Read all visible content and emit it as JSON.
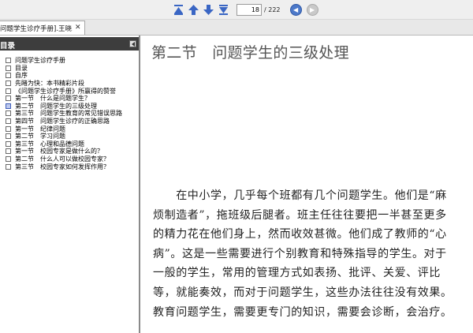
{
  "toolbar": {
    "current_page": "18",
    "total_pages": "/ 222",
    "buttons": [
      "first-page-icon",
      "previous-page-icon",
      "next-page-icon",
      "last-page-icon",
      "go-back-icon",
      "go-forward-icon"
    ],
    "accent_color": "#4d79c9"
  },
  "tab": {
    "title": "问题学生诊疗手册].王晓...",
    "close": "✕"
  },
  "sidebar": {
    "title": "目录",
    "items": [
      {
        "label": "问题学生诊疗手册"
      },
      {
        "label": "目录"
      },
      {
        "label": "自序"
      },
      {
        "label": "先睹为快：本书精彩片段"
      },
      {
        "label": "《问题学生诊疗手册》所赢得的赞誉"
      },
      {
        "label": "第一节　什么是问题学生？"
      },
      {
        "label": "第二节　问题学生的三级处理"
      },
      {
        "label": "第三节　问题学生教育的常见错误思路"
      },
      {
        "label": "第四节　问题学生诊疗的正确思路"
      },
      {
        "label": "第一节　纪律问题"
      },
      {
        "label": "第二节　学习问题"
      },
      {
        "label": "第三节　心理和品德问题"
      },
      {
        "label": "第一节　校园专家是做什么的？"
      },
      {
        "label": "第二节　什么人可以做校园专家？"
      },
      {
        "label": "第三节　校园专家如何发挥作用？"
      }
    ],
    "active_index": 6
  },
  "document": {
    "chapter_title": "第二节　问题学生的三级处理",
    "paragraph_lines": [
      "　　在中小学，几乎每个班都有几个问题学生。他们是“麻",
      "烦制造者”，拖班级后腿者。班主任往往要把一半甚至更多",
      "的精力花在他们身上，然而收效甚微。他们成了教师的“心",
      "病”。这是一些需要进行个别教育和特殊指导的学生。对于",
      "一般的学生，常用的管理方式如表扬、批评、关爱、评比",
      "等，就能奏效，而对于问题学生，这些办法往往没有效果。",
      "教育问题学生，需要更专门的知识，需要会诊断，会治疗。"
    ]
  }
}
